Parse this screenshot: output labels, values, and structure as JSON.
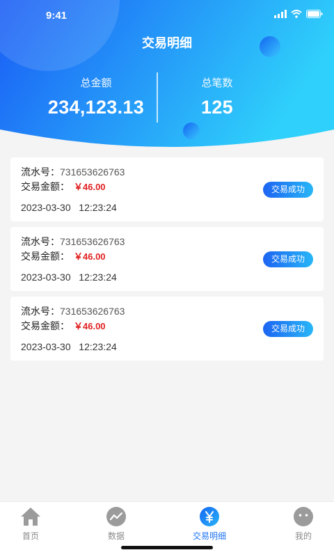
{
  "status_bar": {
    "time": "9:41"
  },
  "header": {
    "title": "交易明细",
    "total_amount_label": "总金额",
    "total_amount_value": "234,123.13",
    "total_count_label": "总笔数",
    "total_count_value": "125"
  },
  "transactions": [
    {
      "serial_label": "流水号：",
      "serial": "731653626763",
      "amount_label": "交易金额：",
      "amount": "￥46.00",
      "date": "2023-03-30",
      "time": "12:23:24",
      "status": "交易成功"
    },
    {
      "serial_label": "流水号：",
      "serial": "731653626763",
      "amount_label": "交易金额：",
      "amount": "￥46.00",
      "date": "2023-03-30",
      "time": "12:23:24",
      "status": "交易成功"
    },
    {
      "serial_label": "流水号：",
      "serial": "731653626763",
      "amount_label": "交易金额：",
      "amount": "￥46.00",
      "date": "2023-03-30",
      "time": "12:23:24",
      "status": "交易成功"
    }
  ],
  "tabbar": {
    "items": [
      {
        "label": "首页",
        "icon": "home-icon",
        "active": false
      },
      {
        "label": "数据",
        "icon": "chart-icon",
        "active": false
      },
      {
        "label": "交易明细",
        "icon": "yen-icon",
        "active": true
      },
      {
        "label": "我的",
        "icon": "profile-icon",
        "active": false
      }
    ]
  },
  "colors": {
    "accent": "#1f74f3",
    "header_gradient_start": "#1a5cf5",
    "header_gradient_end": "#2fd0fb",
    "amount": "#e02020"
  }
}
